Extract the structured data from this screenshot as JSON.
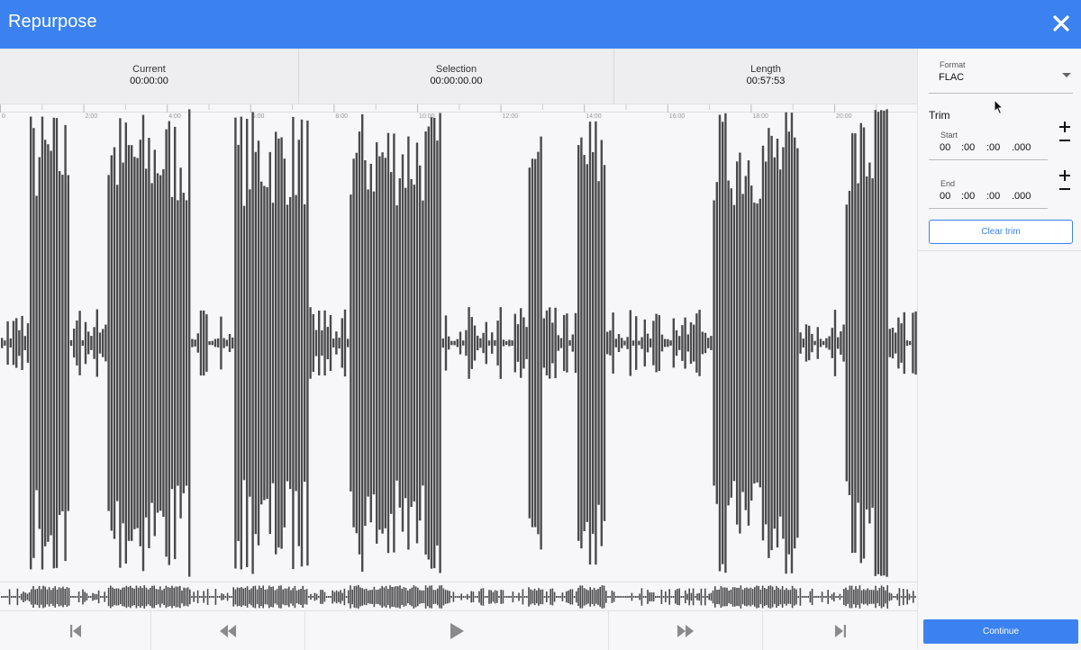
{
  "header": {
    "title": "Repurpose",
    "close_icon": "close-icon"
  },
  "stats": {
    "current": {
      "label": "Current",
      "value": "00:00:00"
    },
    "selection": {
      "label": "Selection",
      "value": "00:00:00.00"
    },
    "length": {
      "label": "Length",
      "value": "00:57:53"
    }
  },
  "timeline": {
    "ticks": [
      "0",
      "2:00",
      "4:00",
      "6:00",
      "8:00",
      "10:00",
      "12:00",
      "14:00",
      "16:00",
      "18:00",
      "20:00"
    ]
  },
  "controls": {
    "icons": [
      "skip-to-start-icon",
      "rewind-icon",
      "play-icon",
      "fast-forward-icon",
      "skip-to-end-icon"
    ]
  },
  "sidebar": {
    "format": {
      "label": "Format",
      "value": "FLAC"
    },
    "trim": {
      "heading": "Trim",
      "start": {
        "label": "Start",
        "hours": "00",
        "minutes": ":00",
        "seconds": ":00",
        "millis": ".000"
      },
      "end": {
        "label": "End",
        "hours": "00",
        "minutes": ":00",
        "seconds": ":00",
        "millis": ".000"
      },
      "clear_label": "Clear trim"
    },
    "continue_label": "Continue"
  },
  "colors": {
    "accent": "#3b82f0",
    "waveform": "#4a4a4c",
    "background": "#f7f6f9"
  }
}
